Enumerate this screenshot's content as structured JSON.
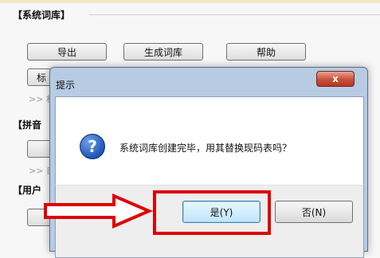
{
  "colors": {
    "highlight": "#e00000",
    "dialog_frame": "#b7cbe2",
    "close_button": "#c9503a"
  },
  "background": {
    "system_dict": {
      "title": "【系统词库】",
      "buttons": [
        "导出",
        "生成词库",
        "帮助"
      ],
      "row2_button_partial": "标",
      "hint_partial": ">> 村"
    },
    "pinyin": {
      "title_partial": "【拼音",
      "hint_partial": ">> 自"
    },
    "user": {
      "title_partial": "【用户"
    }
  },
  "dialog": {
    "title": "提示",
    "close_glyph": "x",
    "icon": "question-icon",
    "icon_glyph": "?",
    "message": "系统词库创建完毕，用其替换现码表吗？",
    "yes_button": "是(Y)",
    "no_button": "否(N)"
  },
  "annotation": {
    "arrow_icon": "arrow-right-icon",
    "box": "highlight-box"
  }
}
